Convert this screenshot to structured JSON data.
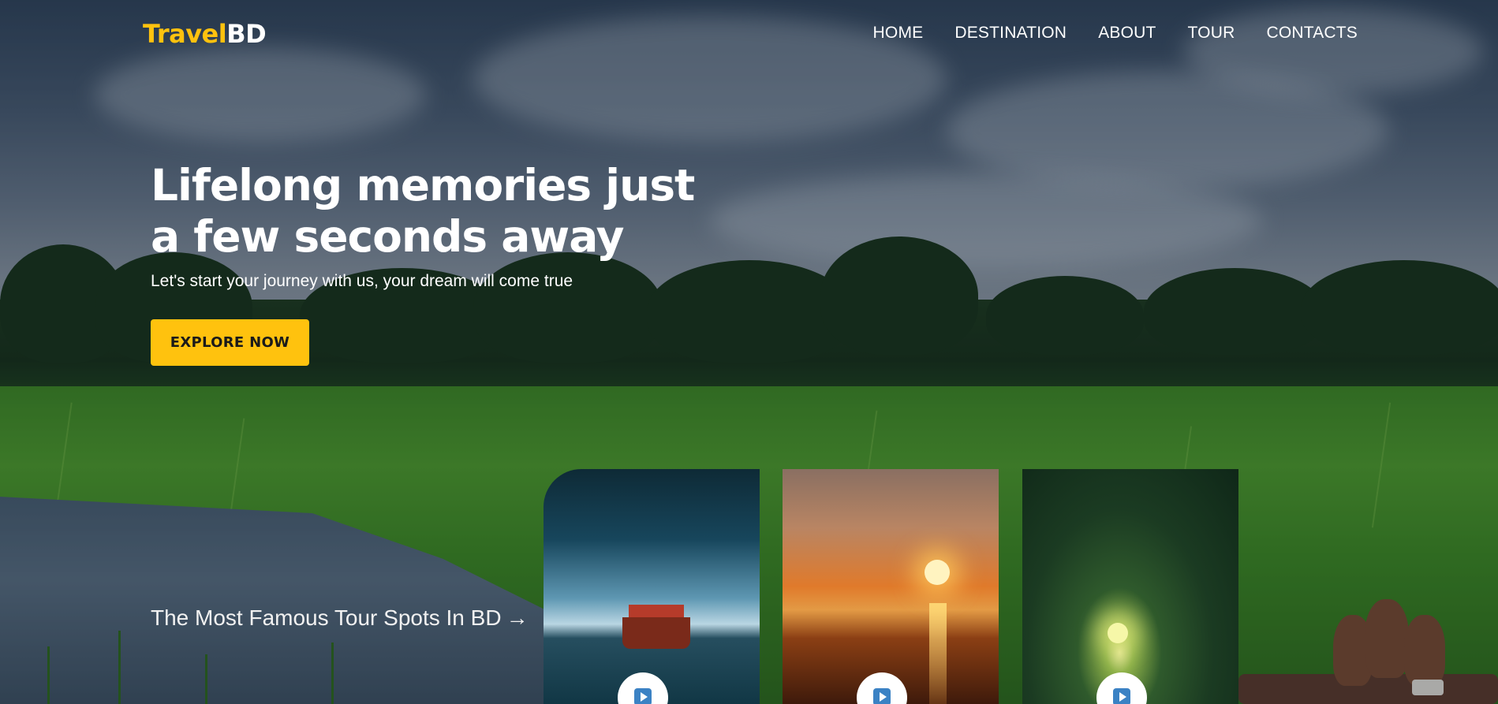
{
  "brand": {
    "part1": "Travel",
    "part2": "BD",
    "accent_color": "#ffc20e"
  },
  "nav": {
    "items": [
      {
        "label": "HOME"
      },
      {
        "label": "DESTINATION"
      },
      {
        "label": "ABOUT"
      },
      {
        "label": "TOUR"
      },
      {
        "label": "CONTACTS"
      }
    ]
  },
  "hero": {
    "title": "Lifelong memories just a few seconds away",
    "subtitle": "Let's start your journey with us, your dream will come true",
    "cta_label": "EXPLORE NOW"
  },
  "spots": {
    "heading": "The Most Famous Tour Spots In BD",
    "arrow": "→",
    "cards": [
      {
        "icon": "play-icon"
      },
      {
        "icon": "play-icon"
      },
      {
        "icon": "play-icon"
      }
    ]
  },
  "colors": {
    "cta_bg": "#ffc20e",
    "play_icon": "#3b82c4"
  }
}
